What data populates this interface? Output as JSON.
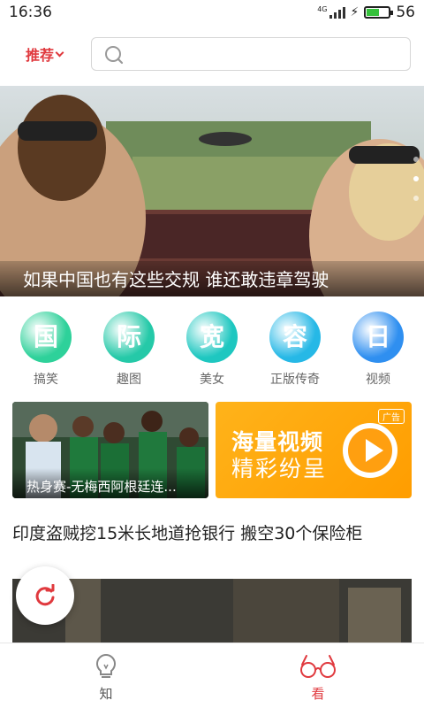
{
  "status_bar": {
    "time": "16:36",
    "network": "4G",
    "battery": "56",
    "battery_level": 0.56
  },
  "header": {
    "recommend_label": "推荐",
    "search_placeholder": ""
  },
  "banner": {
    "caption": "如果中国也有这些交规 谁还敢违章驾驶",
    "page_count": 3,
    "active_page": 1
  },
  "categories": [
    {
      "glyph": "国",
      "label": "搞笑",
      "color": "#2ed19a"
    },
    {
      "glyph": "际",
      "label": "趣图",
      "color": "#25c9a8"
    },
    {
      "glyph": "宽",
      "label": "美女",
      "color": "#1ec7c0"
    },
    {
      "glyph": "容",
      "label": "正版传奇",
      "color": "#26b8e6"
    },
    {
      "glyph": "日",
      "label": "视频",
      "color": "#2f8ff0"
    }
  ],
  "cards": {
    "left_caption": "热身赛-无梅西阿根廷连...",
    "ad_badge": "广告",
    "ad_line1": "海量视频",
    "ad_line2": "精彩纷呈"
  },
  "article": {
    "title": "印度盗贼挖15米长地道抢银行 搬空30个保险柜"
  },
  "bottom_nav": [
    {
      "label": "知",
      "icon": "lightbulb-icon",
      "active": false
    },
    {
      "label": "看",
      "icon": "glasses-icon",
      "active": true
    }
  ],
  "colors": {
    "accent": "#e0393e",
    "ad_orange": "#ff9f10"
  }
}
